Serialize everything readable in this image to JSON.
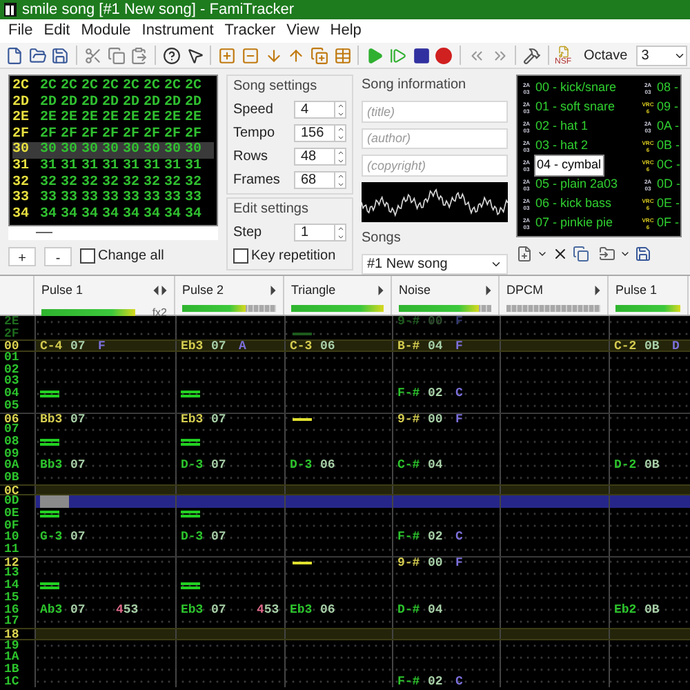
{
  "window": {
    "title": "smile song [#1 New song] - FamiTracker"
  },
  "menu": [
    "File",
    "Edit",
    "Module",
    "Instrument",
    "Tracker",
    "View",
    "Help"
  ],
  "toolbar": {
    "export_label": "NSF",
    "octave_label": "Octave",
    "octave": "3"
  },
  "frames": [
    {
      "number": "2C",
      "selected": false,
      "cells": [
        "2C",
        "2C",
        "2C",
        "2C",
        "2C",
        "2C",
        "2C",
        "2C"
      ]
    },
    {
      "number": "2D",
      "selected": false,
      "cells": [
        "2D",
        "2D",
        "2D",
        "2D",
        "2D",
        "2D",
        "2D",
        "2D"
      ]
    },
    {
      "number": "2E",
      "selected": false,
      "cells": [
        "2E",
        "2E",
        "2E",
        "2E",
        "2E",
        "2E",
        "2E",
        "2E"
      ]
    },
    {
      "number": "2F",
      "selected": false,
      "cells": [
        "2F",
        "2F",
        "2F",
        "2F",
        "2F",
        "2F",
        "2F",
        "2F"
      ]
    },
    {
      "number": "30",
      "selected": true,
      "cells": [
        "30",
        "30",
        "30",
        "30",
        "30",
        "30",
        "30",
        "30"
      ]
    },
    {
      "number": "31",
      "selected": false,
      "cells": [
        "31",
        "31",
        "31",
        "31",
        "31",
        "31",
        "31",
        "31"
      ]
    },
    {
      "number": "32",
      "selected": false,
      "cells": [
        "32",
        "32",
        "32",
        "32",
        "32",
        "32",
        "32",
        "32"
      ]
    },
    {
      "number": "33",
      "selected": false,
      "cells": [
        "33",
        "33",
        "33",
        "33",
        "33",
        "33",
        "33",
        "33"
      ]
    },
    {
      "number": "34",
      "selected": false,
      "cells": [
        "34",
        "34",
        "34",
        "34",
        "34",
        "34",
        "34",
        "34"
      ]
    }
  ],
  "frame_controls": {
    "add": "+",
    "remove": "-",
    "change_all": {
      "label": "Change all",
      "checked": false
    }
  },
  "song_settings": {
    "title": "Song settings",
    "fields": [
      {
        "label": "Speed",
        "value": "4"
      },
      {
        "label": "Tempo",
        "value": "156"
      },
      {
        "label": "Rows",
        "value": "48"
      },
      {
        "label": "Frames",
        "value": "68"
      }
    ]
  },
  "edit_settings": {
    "title": "Edit settings",
    "step": {
      "label": "Step",
      "value": "1"
    },
    "key_repetition": {
      "label": "Key repetition",
      "checked": false
    }
  },
  "song_information": {
    "title": "Song information",
    "fields": [
      {
        "placeholder": "(title)"
      },
      {
        "placeholder": "(author)"
      },
      {
        "placeholder": "(copyright)"
      }
    ]
  },
  "songs": {
    "title": "Songs",
    "value": "#1 New song"
  },
  "instruments": [
    {
      "kind": "apu",
      "chip": [
        "2A",
        "03"
      ],
      "label": "00 - kick/snare",
      "selected": false
    },
    {
      "kind": "apu",
      "chip": [
        "2A",
        "03"
      ],
      "label": "01 - soft snare",
      "selected": false
    },
    {
      "kind": "apu",
      "chip": [
        "2A",
        "03"
      ],
      "label": "02 - hat 1",
      "selected": false
    },
    {
      "kind": "apu",
      "chip": [
        "2A",
        "03"
      ],
      "label": "03 - hat 2",
      "selected": false
    },
    {
      "kind": "apu",
      "chip": [
        "2A",
        "03"
      ],
      "label": "04 - cymbal",
      "selected": true
    },
    {
      "kind": "apu",
      "chip": [
        "2A",
        "03"
      ],
      "label": "05 - plain 2a03",
      "selected": false
    },
    {
      "kind": "apu",
      "chip": [
        "2A",
        "03"
      ],
      "label": "06 - kick bass",
      "selected": false
    },
    {
      "kind": "apu",
      "chip": [
        "2A",
        "03"
      ],
      "label": "07 - pinkie pie",
      "selected": false
    },
    {
      "kind": "apu",
      "chip": [
        "2A",
        "03"
      ],
      "label": "08 -",
      "selected": false
    },
    {
      "kind": "vrc",
      "chip": [
        "VRC",
        "6"
      ],
      "label": "09 -",
      "selected": false
    },
    {
      "kind": "apu",
      "chip": [
        "2A",
        "03"
      ],
      "label": "0A -",
      "selected": false
    },
    {
      "kind": "vrc",
      "chip": [
        "VRC",
        "6"
      ],
      "label": "0B -",
      "selected": false
    },
    {
      "kind": "vrc",
      "chip": [
        "VRC",
        "6"
      ],
      "label": "0C -",
      "selected": false
    },
    {
      "kind": "apu",
      "chip": [
        "2A",
        "03"
      ],
      "label": "0D -",
      "selected": false
    },
    {
      "kind": "vrc",
      "chip": [
        "VRC",
        "6"
      ],
      "label": "0E -",
      "selected": false
    },
    {
      "kind": "vrc",
      "chip": [
        "VRC",
        "6"
      ],
      "label": "0F -",
      "selected": false
    }
  ],
  "channels": [
    {
      "name": "Pulse 1",
      "level": 1,
      "left_arrow": true,
      "right_arrow": true,
      "extra": "fx2"
    },
    {
      "name": "Pulse 2",
      "level": 0.68,
      "left_arrow": false,
      "right_arrow": true
    },
    {
      "name": "Triangle",
      "level": 1,
      "left_arrow": false,
      "right_arrow": true
    },
    {
      "name": "Noise",
      "level": 0.86,
      "left_arrow": false,
      "right_arrow": true
    },
    {
      "name": "DPCM",
      "level": 0,
      "left_arrow": false,
      "right_arrow": true
    },
    {
      "name": "Pulse 1",
      "level": 1,
      "left_arrow": false,
      "right_arrow": false
    }
  ],
  "pattern": [
    {
      "number": "2E",
      "kind": "plain",
      "dim": true,
      "cells": [
        {
          "kind": "empty"
        },
        {
          "kind": "empty"
        },
        {
          "kind": "empty"
        },
        {
          "kind": "note",
          "note": "9-#",
          "instrument": "00",
          "volume": "F"
        },
        {
          "kind": "empty"
        },
        {
          "kind": "empty"
        }
      ]
    },
    {
      "number": "2F",
      "kind": "plain",
      "dim": true,
      "cells": [
        {
          "kind": "empty"
        },
        {
          "kind": "empty"
        },
        {
          "kind": "release"
        },
        {
          "kind": "empty"
        },
        {
          "kind": "empty"
        },
        {
          "kind": "empty"
        }
      ]
    },
    {
      "number": "00",
      "kind": "primary",
      "dim": false,
      "cells": [
        {
          "kind": "note",
          "note": "C-4",
          "instrument": "07",
          "volume": "F"
        },
        {
          "kind": "note",
          "note": "Eb3",
          "instrument": "07",
          "volume": "A"
        },
        {
          "kind": "note",
          "note": "C-3",
          "instrument": "06"
        },
        {
          "kind": "note",
          "note": "B-#",
          "instrument": "04",
          "volume": "F"
        },
        {
          "kind": "empty"
        },
        {
          "kind": "note",
          "note": "C-2",
          "instrument": "0B",
          "volume": "D"
        }
      ]
    },
    {
      "number": "01",
      "kind": "plain",
      "dim": false
    },
    {
      "number": "02",
      "kind": "plain",
      "dim": false
    },
    {
      "number": "03",
      "kind": "plain",
      "dim": false
    },
    {
      "number": "04",
      "kind": "plain",
      "dim": false,
      "cells": [
        {
          "kind": "off"
        },
        {
          "kind": "off"
        },
        {
          "kind": "empty"
        },
        {
          "kind": "note",
          "note": "F-#",
          "instrument": "02",
          "volume": "C"
        },
        {
          "kind": "empty"
        },
        {
          "kind": "empty"
        }
      ]
    },
    {
      "number": "05",
      "kind": "plain",
      "dim": false
    },
    {
      "number": "06",
      "kind": "secondary",
      "dim": false,
      "cells": [
        {
          "kind": "note",
          "note": "Bb3",
          "instrument": "07"
        },
        {
          "kind": "note",
          "note": "Eb3",
          "instrument": "07"
        },
        {
          "kind": "release"
        },
        {
          "kind": "note",
          "note": "9-#",
          "instrument": "00",
          "volume": "F"
        },
        {
          "kind": "empty"
        },
        {
          "kind": "empty"
        }
      ]
    },
    {
      "number": "07",
      "kind": "plain",
      "dim": false
    },
    {
      "number": "08",
      "kind": "plain",
      "dim": false,
      "cells": [
        {
          "kind": "off"
        },
        {
          "kind": "off"
        },
        {
          "kind": "empty"
        },
        {
          "kind": "empty"
        },
        {
          "kind": "empty"
        },
        {
          "kind": "empty"
        }
      ]
    },
    {
      "number": "09",
      "kind": "plain",
      "dim": false
    },
    {
      "number": "0A",
      "kind": "plain",
      "dim": false,
      "cells": [
        {
          "kind": "note",
          "note": "Bb3",
          "instrument": "07"
        },
        {
          "kind": "note",
          "note": "D-3",
          "instrument": "07"
        },
        {
          "kind": "note",
          "note": "D-3",
          "instrument": "06"
        },
        {
          "kind": "note",
          "note": "C-#",
          "instrument": "04"
        },
        {
          "kind": "empty"
        },
        {
          "kind": "note",
          "note": "D-2",
          "instrument": "0B"
        }
      ]
    },
    {
      "number": "0B",
      "kind": "plain",
      "dim": false
    },
    {
      "number": "0C",
      "kind": "primary",
      "dim": false
    },
    {
      "number": "0D",
      "kind": "cursor",
      "dim": false
    },
    {
      "number": "0E",
      "kind": "plain",
      "dim": false,
      "cells": [
        {
          "kind": "off"
        },
        {
          "kind": "off"
        },
        {
          "kind": "empty"
        },
        {
          "kind": "empty"
        },
        {
          "kind": "empty"
        },
        {
          "kind": "empty"
        }
      ]
    },
    {
      "number": "0F",
      "kind": "plain",
      "dim": false
    },
    {
      "number": "10",
      "kind": "plain",
      "dim": false,
      "cells": [
        {
          "kind": "note",
          "note": "G-3",
          "instrument": "07"
        },
        {
          "kind": "note",
          "note": "D-3",
          "instrument": "07"
        },
        {
          "kind": "empty"
        },
        {
          "kind": "note",
          "note": "F-#",
          "instrument": "02",
          "volume": "C"
        },
        {
          "kind": "empty"
        },
        {
          "kind": "empty"
        }
      ]
    },
    {
      "number": "11",
      "kind": "plain",
      "dim": false
    },
    {
      "number": "12",
      "kind": "secondary",
      "dim": false,
      "cells": [
        {
          "kind": "empty"
        },
        {
          "kind": "empty"
        },
        {
          "kind": "release"
        },
        {
          "kind": "note",
          "note": "9-#",
          "instrument": "00",
          "volume": "F"
        },
        {
          "kind": "empty"
        },
        {
          "kind": "empty"
        }
      ]
    },
    {
      "number": "13",
      "kind": "plain",
      "dim": false
    },
    {
      "number": "14",
      "kind": "plain",
      "dim": false,
      "cells": [
        {
          "kind": "off"
        },
        {
          "kind": "off"
        },
        {
          "kind": "empty"
        },
        {
          "kind": "empty"
        },
        {
          "kind": "empty"
        },
        {
          "kind": "empty"
        }
      ]
    },
    {
      "number": "15",
      "kind": "plain",
      "dim": false
    },
    {
      "number": "16",
      "kind": "plain",
      "dim": false,
      "cells": [
        {
          "kind": "note",
          "note": "Ab3",
          "instrument": "07",
          "effect": "453"
        },
        {
          "kind": "note",
          "note": "Eb3",
          "instrument": "07",
          "effect": "453"
        },
        {
          "kind": "note",
          "note": "Eb3",
          "instrument": "06"
        },
        {
          "kind": "note",
          "note": "D-#",
          "instrument": "04"
        },
        {
          "kind": "empty"
        },
        {
          "kind": "note",
          "note": "Eb2",
          "instrument": "0B"
        }
      ]
    },
    {
      "number": "17",
      "kind": "plain",
      "dim": false
    },
    {
      "number": "18",
      "kind": "primary",
      "dim": false
    },
    {
      "number": "19",
      "kind": "plain",
      "dim": false
    },
    {
      "number": "1A",
      "kind": "plain",
      "dim": false
    },
    {
      "number": "1B",
      "kind": "plain",
      "dim": false
    },
    {
      "number": "1C",
      "kind": "plain",
      "dim": false,
      "cells": [
        {
          "kind": "empty"
        },
        {
          "kind": "empty"
        },
        {
          "kind": "empty"
        },
        {
          "kind": "note",
          "note": "F-#",
          "instrument": "02",
          "volume": "C"
        },
        {
          "kind": "empty"
        },
        {
          "kind": "empty"
        }
      ]
    }
  ]
}
